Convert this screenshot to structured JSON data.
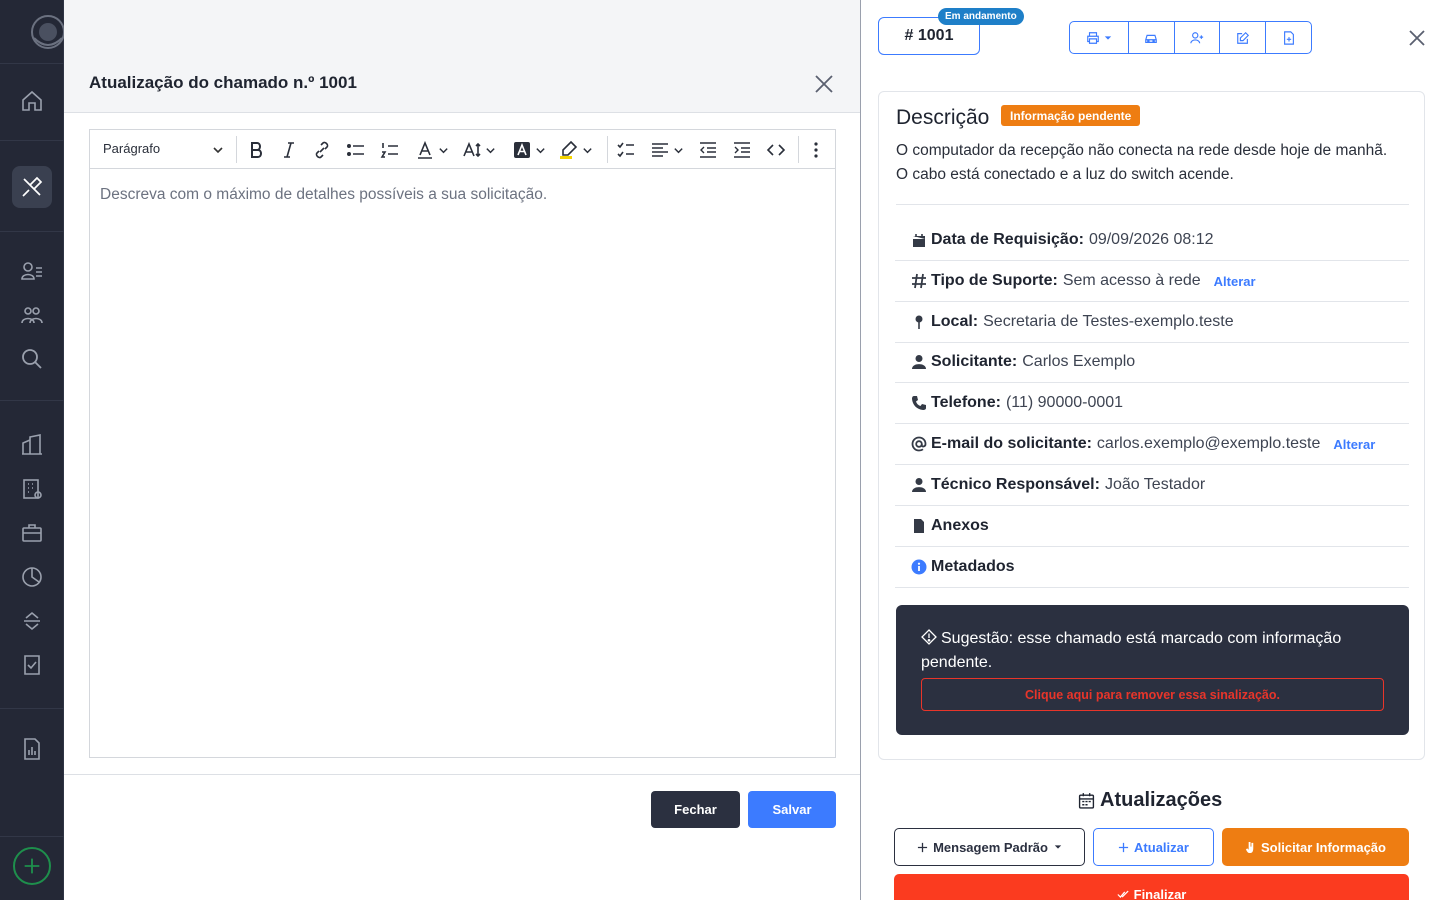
{
  "modal": {
    "title": "Atualização do chamado n.º 1001",
    "toolbar": {
      "paragraph_select": "Parágrafo"
    },
    "editor_placeholder": "Descreva com o máximo de detalhes possíveis a sua solicitação.",
    "buttons": {
      "close": "Fechar",
      "save": "Salvar"
    }
  },
  "panel": {
    "ticket_number": "# 1001",
    "status_badge": "Em andamento",
    "description": {
      "heading": "Descrição",
      "badge": "Informação pendente",
      "lines": [
        "O computador da recepção não conecta na rede desde hoje de manhã.",
        "O cabo está conectado e a luz do switch acende."
      ]
    },
    "info": [
      {
        "label": "Data de Requisição:",
        "value": "09/09/2026 08:12",
        "icon": "calendar-icon"
      },
      {
        "label": "Tipo de Suporte:",
        "value": "Sem acesso à rede",
        "icon": "hash-icon",
        "action": "Alterar"
      },
      {
        "label": "Local:",
        "value": "Secretaria de Testes-exemplo.teste",
        "icon": "pin-icon"
      },
      {
        "label": "Solicitante:",
        "value": "Carlos Exemplo",
        "icon": "user-icon"
      },
      {
        "label": "Telefone:",
        "value": "(11) 90000-0001",
        "icon": "phone-icon"
      },
      {
        "label": "E-mail do solicitante:",
        "value": "carlos.exemplo@exemplo.teste",
        "icon": "at-icon",
        "action": "Alterar"
      },
      {
        "label": "Técnico Responsável:",
        "value": "João Testador",
        "icon": "user-icon"
      },
      {
        "label": "Anexos",
        "icon": "file-icon"
      },
      {
        "label": "Metadados",
        "icon": "info-icon"
      }
    ],
    "suggestion": {
      "text": "Sugestão: esse chamado está marcado com informação pendente.",
      "button": "Clique aqui para remover essa sinalização."
    },
    "updates": {
      "heading": "Atualizações",
      "buttons": {
        "default_message": "Mensagem Padrão",
        "update": "Atualizar",
        "request_info": "Solicitar Informação",
        "finalize": "Finalizar"
      }
    }
  },
  "colors": {
    "accent": "#3c7bff",
    "sidebar": "#242836",
    "warning": "#ee7d12",
    "danger": "#fb3b1f",
    "dark": "#2b3040"
  }
}
